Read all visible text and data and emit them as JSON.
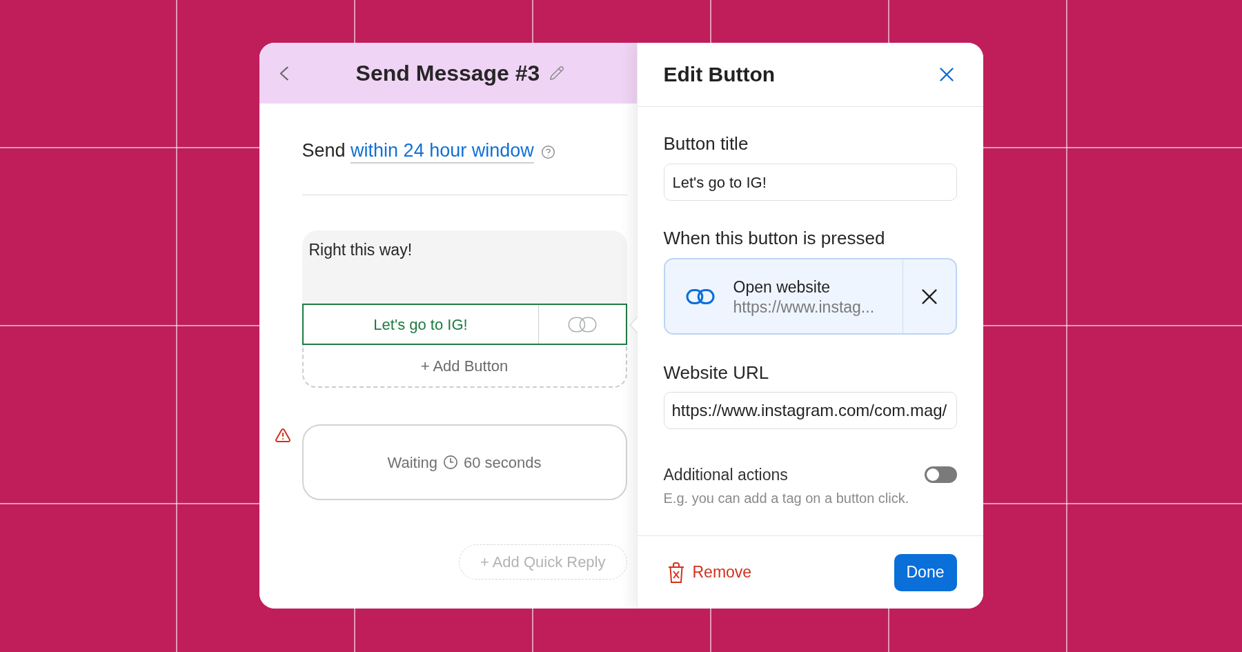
{
  "editor": {
    "title": "Send Message #3",
    "send_label": "Send",
    "send_window": "within 24 hour window",
    "message": {
      "text": "Right this way!",
      "buttons": [
        {
          "label": "Let's go to IG!",
          "selected": true
        }
      ],
      "add_button": "+ Add Button"
    },
    "wait_step": {
      "warning": true,
      "label": "Waiting",
      "duration": "60 seconds"
    },
    "add_quick_reply": "+ Add Quick Reply"
  },
  "edit_panel": {
    "title": "Edit Button",
    "button_title": {
      "label": "Button title",
      "value": "Let's go to IG!"
    },
    "action": {
      "label": "When this button is pressed",
      "title": "Open website",
      "url": "https://www.instag..."
    },
    "website_url": {
      "label": "Website URL",
      "value": "https://www.instagram.com/com.mag/"
    },
    "additional_actions": {
      "label": "Additional actions",
      "on": false,
      "hint": "E.g. you can add a tag on a button click."
    },
    "remove": "Remove",
    "done": "Done"
  }
}
